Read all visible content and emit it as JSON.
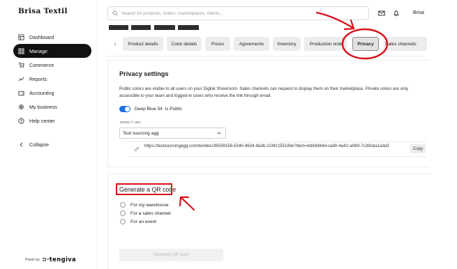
{
  "app": {
    "brand": "Brisa Textil",
    "user": "Brisa"
  },
  "sidebar": {
    "items": [
      {
        "label": "Dashboard",
        "icon": "dashboard-icon"
      },
      {
        "label": "Manage",
        "icon": "grid-icon",
        "active": true
      },
      {
        "label": "Commerce",
        "icon": "cart-icon"
      },
      {
        "label": "Reports",
        "icon": "chart-icon"
      },
      {
        "label": "Accounting",
        "icon": "wallet-icon"
      },
      {
        "label": "My business",
        "icon": "gear-icon"
      },
      {
        "label": "Help center",
        "icon": "help-icon"
      }
    ],
    "collapse_label": "Collapse",
    "powered_by": "Power by",
    "powered_logo": "tengiva"
  },
  "search": {
    "placeholder": "Search for products, orders, marketplaces, clients..."
  },
  "tabs": {
    "items": [
      "Product details",
      "Color details",
      "Prices",
      "Agreements",
      "Inventory",
      "Production order",
      "Privacy",
      "Sales channels"
    ],
    "active": "Privacy"
  },
  "privacy": {
    "title": "Privacy settings",
    "description": "Public colors are visible to all users on your Digital Showroom. Sales channels can request to display them on their marketplace. Private colors are only accessible to your team and logged-in users who receive the link through email.",
    "toggle_name": "Deep Blue 54",
    "toggle_status": "is Public",
    "toggle_on": true,
    "direct_url_label": "DIRECT URL",
    "select_value": "Text sourcing agg",
    "url": "https://textsourcingagg.com/textiles/36509158-5340-4634-9a3b-224fc155189e?item=6d9d484d-ca90-4a42-a089-7c39cba1a3d3",
    "copy_label": "Copy"
  },
  "qr": {
    "title": "Generate a QR code",
    "options": [
      "For my warehouse",
      "For a sales channel",
      "For an event"
    ],
    "button_label": "Generate QR code"
  },
  "colors": {
    "accent": "#1f6fe0",
    "annotation": "#d9101a",
    "active_nav": "#111111"
  }
}
